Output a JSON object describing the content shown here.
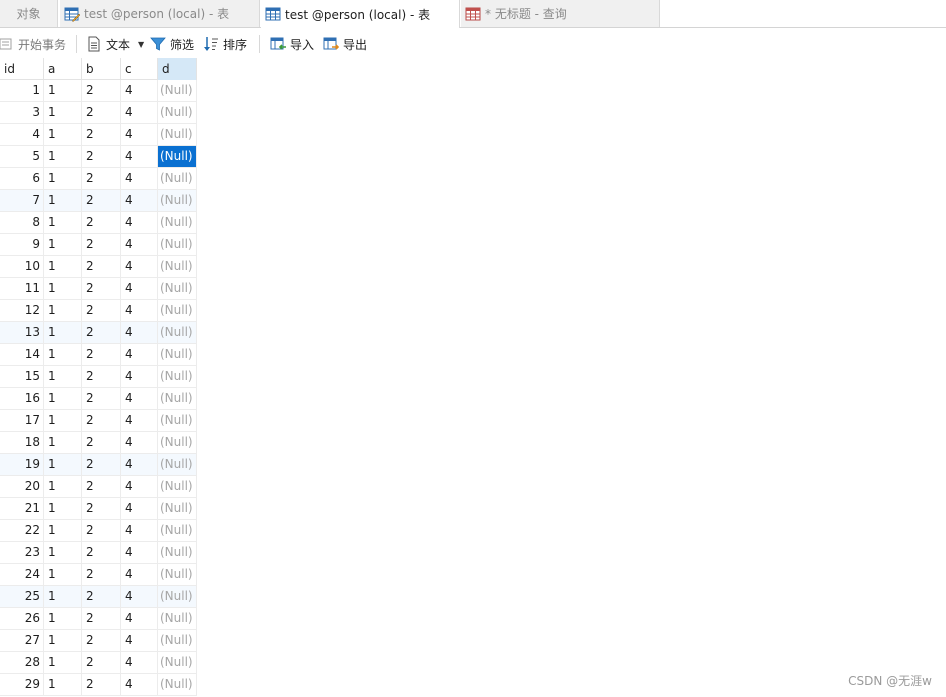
{
  "tabs": {
    "objects": "对象",
    "tab1": "test @person (local) - 表",
    "tab2": "test @person (local) - 表",
    "tab3": "* 无标题 - 查询"
  },
  "toolbar": {
    "begin_transaction": "开始事务",
    "text": "文本",
    "filter": "筛选",
    "sort": "排序",
    "import": "导入",
    "export": "导出"
  },
  "table": {
    "columns": [
      "id",
      "a",
      "b",
      "c",
      "d"
    ],
    "selected_column": "d",
    "selected_row_index": 3,
    "rows": [
      [
        "1",
        "1",
        "2",
        "4",
        "(Null)"
      ],
      [
        "3",
        "1",
        "2",
        "4",
        "(Null)"
      ],
      [
        "4",
        "1",
        "2",
        "4",
        "(Null)"
      ],
      [
        "5",
        "1",
        "2",
        "4",
        "(Null)"
      ],
      [
        "6",
        "1",
        "2",
        "4",
        "(Null)"
      ],
      [
        "7",
        "1",
        "2",
        "4",
        "(Null)"
      ],
      [
        "8",
        "1",
        "2",
        "4",
        "(Null)"
      ],
      [
        "9",
        "1",
        "2",
        "4",
        "(Null)"
      ],
      [
        "10",
        "1",
        "2",
        "4",
        "(Null)"
      ],
      [
        "11",
        "1",
        "2",
        "4",
        "(Null)"
      ],
      [
        "12",
        "1",
        "2",
        "4",
        "(Null)"
      ],
      [
        "13",
        "1",
        "2",
        "4",
        "(Null)"
      ],
      [
        "14",
        "1",
        "2",
        "4",
        "(Null)"
      ],
      [
        "15",
        "1",
        "2",
        "4",
        "(Null)"
      ],
      [
        "16",
        "1",
        "2",
        "4",
        "(Null)"
      ],
      [
        "17",
        "1",
        "2",
        "4",
        "(Null)"
      ],
      [
        "18",
        "1",
        "2",
        "4",
        "(Null)"
      ],
      [
        "19",
        "1",
        "2",
        "4",
        "(Null)"
      ],
      [
        "20",
        "1",
        "2",
        "4",
        "(Null)"
      ],
      [
        "21",
        "1",
        "2",
        "4",
        "(Null)"
      ],
      [
        "22",
        "1",
        "2",
        "4",
        "(Null)"
      ],
      [
        "23",
        "1",
        "2",
        "4",
        "(Null)"
      ],
      [
        "24",
        "1",
        "2",
        "4",
        "(Null)"
      ],
      [
        "25",
        "1",
        "2",
        "4",
        "(Null)"
      ],
      [
        "26",
        "1",
        "2",
        "4",
        "(Null)"
      ],
      [
        "27",
        "1",
        "2",
        "4",
        "(Null)"
      ],
      [
        "28",
        "1",
        "2",
        "4",
        "(Null)"
      ],
      [
        "29",
        "1",
        "2",
        "4",
        "(Null)"
      ]
    ]
  },
  "icons": {
    "tab1": "table-edit-icon",
    "tab2": "table-icon",
    "tab3": "query-icon",
    "begin_transaction": "transaction-icon",
    "text": "document-icon",
    "filter": "filter-icon",
    "sort": "sort-icon",
    "import": "import-icon",
    "export": "export-icon"
  },
  "colors": {
    "accent": "#0a70d1",
    "selected_header": "#d5e8f7",
    "null_text": "#a6a6a6"
  },
  "watermark": "CSDN @无涯w"
}
